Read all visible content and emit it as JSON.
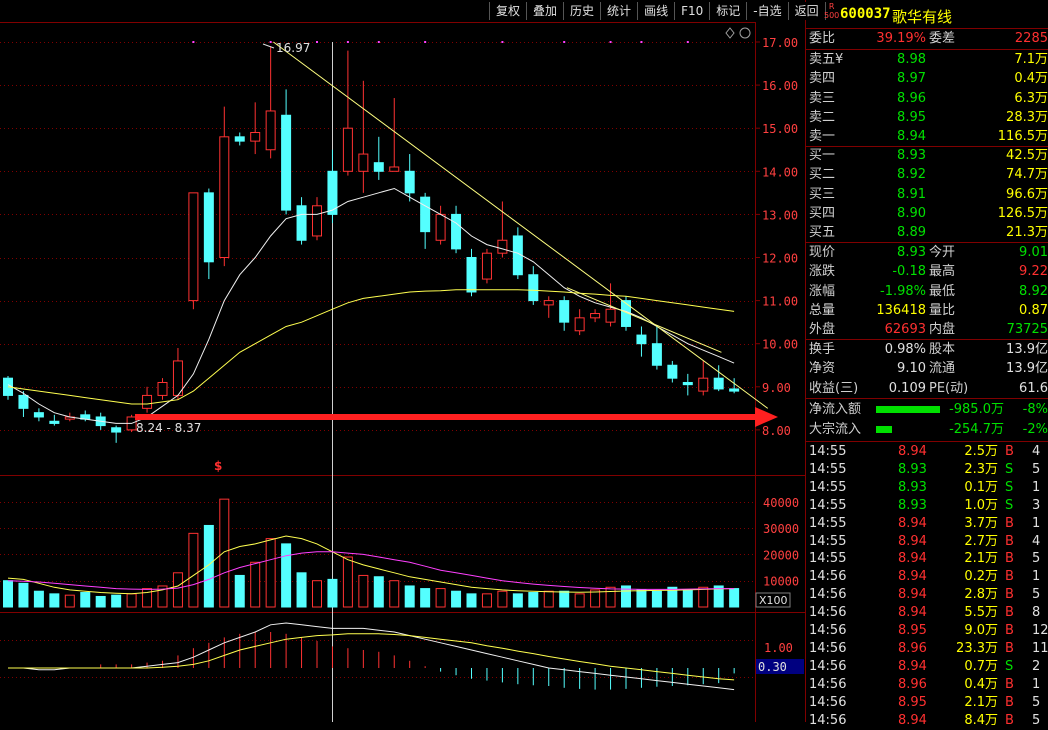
{
  "toolbar": [
    "复权",
    "叠加",
    "历史",
    "统计",
    "画线",
    "F10",
    "标记",
    "-自选",
    "返回"
  ],
  "stock": {
    "market_badge_top": "R",
    "market_badge_bottom": "500",
    "code": "600037",
    "name": "歌华有线"
  },
  "price_axis": [
    "17.00",
    "16.00",
    "15.00",
    "14.00",
    "13.00",
    "12.00",
    "11.00",
    "10.00",
    "9.00",
    "8.00"
  ],
  "volume_axis": [
    "40000",
    "30000",
    "20000",
    "10000"
  ],
  "volume_unit": "X100",
  "macd_axis": [
    "1.00",
    "0.30"
  ],
  "annotations": {
    "high_label": "16.97",
    "range_label": "8.24 - 8.37",
    "marker": "$"
  },
  "order_book": {
    "weibi_label": "委比",
    "weibi_value": "39.19%",
    "weicha_label": "委差",
    "weicha_value": "2285",
    "asks": [
      {
        "label": "卖五",
        "flag": "¥",
        "price": "8.98",
        "vol": "7.1万"
      },
      {
        "label": "卖四",
        "flag": "",
        "price": "8.97",
        "vol": "0.4万"
      },
      {
        "label": "卖三",
        "flag": "",
        "price": "8.96",
        "vol": "6.3万"
      },
      {
        "label": "卖二",
        "flag": "",
        "price": "8.95",
        "vol": "28.3万"
      },
      {
        "label": "卖一",
        "flag": "",
        "price": "8.94",
        "vol": "116.5万"
      }
    ],
    "bids": [
      {
        "label": "买一",
        "price": "8.93",
        "vol": "42.5万"
      },
      {
        "label": "买二",
        "price": "8.92",
        "vol": "74.7万"
      },
      {
        "label": "买三",
        "price": "8.91",
        "vol": "96.6万"
      },
      {
        "label": "买四",
        "price": "8.90",
        "vol": "126.5万"
      },
      {
        "label": "买五",
        "price": "8.89",
        "vol": "21.3万"
      }
    ]
  },
  "quote": [
    {
      "l1": "现价",
      "v1": "8.93",
      "c1": "grn",
      "l2": "今开",
      "v2": "9.01",
      "c2": "grn"
    },
    {
      "l1": "涨跌",
      "v1": "-0.18",
      "c1": "grn",
      "l2": "最高",
      "v2": "9.22",
      "c2": "red"
    },
    {
      "l1": "涨幅",
      "v1": "-1.98%",
      "c1": "grn",
      "l2": "最低",
      "v2": "8.92",
      "c2": "grn"
    },
    {
      "l1": "总量",
      "v1": "136418",
      "c1": "yel",
      "l2": "量比",
      "v2": "0.87",
      "c2": "yel"
    },
    {
      "l1": "外盘",
      "v1": "62693",
      "c1": "red",
      "l2": "内盘",
      "v2": "73725",
      "c2": "grn"
    }
  ],
  "fundamentals": [
    {
      "l1": "换手",
      "v1": "0.98%",
      "l2": "股本",
      "v2": "13.9亿"
    },
    {
      "l1": "净资",
      "v1": "9.10",
      "l2": "流通",
      "v2": "13.9亿"
    },
    {
      "l1": "收益(三)",
      "v1": "0.109",
      "l2": "PE(动)",
      "v2": "61.6"
    }
  ],
  "flows": [
    {
      "label": "净流入额",
      "value": "-985.0万",
      "pct": "-8%"
    },
    {
      "label": "大宗流入",
      "value": "-254.7万",
      "pct": "-2%"
    }
  ],
  "ticks": [
    {
      "t": "14:55",
      "p": "8.94",
      "v": "2.5万",
      "s": "B",
      "n": "4"
    },
    {
      "t": "14:55",
      "p": "8.93",
      "v": "2.3万",
      "s": "S",
      "n": "5"
    },
    {
      "t": "14:55",
      "p": "8.93",
      "v": "0.1万",
      "s": "S",
      "n": "1"
    },
    {
      "t": "14:55",
      "p": "8.93",
      "v": "1.0万",
      "s": "S",
      "n": "3"
    },
    {
      "t": "14:55",
      "p": "8.94",
      "v": "3.7万",
      "s": "B",
      "n": "1"
    },
    {
      "t": "14:55",
      "p": "8.94",
      "v": "2.7万",
      "s": "B",
      "n": "4"
    },
    {
      "t": "14:55",
      "p": "8.94",
      "v": "2.1万",
      "s": "B",
      "n": "5"
    },
    {
      "t": "14:56",
      "p": "8.94",
      "v": "0.2万",
      "s": "B",
      "n": "1"
    },
    {
      "t": "14:56",
      "p": "8.94",
      "v": "2.8万",
      "s": "B",
      "n": "5"
    },
    {
      "t": "14:56",
      "p": "8.94",
      "v": "5.5万",
      "s": "B",
      "n": "8"
    },
    {
      "t": "14:56",
      "p": "8.95",
      "v": "9.0万",
      "s": "B",
      "n": "12"
    },
    {
      "t": "14:56",
      "p": "8.96",
      "v": "23.3万",
      "s": "B",
      "n": "11"
    },
    {
      "t": "14:56",
      "p": "8.94",
      "v": "0.7万",
      "s": "S",
      "n": "2"
    },
    {
      "t": "14:56",
      "p": "8.96",
      "v": "0.4万",
      "s": "B",
      "n": "1"
    },
    {
      "t": "14:56",
      "p": "8.95",
      "v": "2.1万",
      "s": "B",
      "n": "5"
    },
    {
      "t": "14:56",
      "p": "8.94",
      "v": "8.4万",
      "s": "B",
      "n": "5"
    }
  ],
  "colors": {
    "up": "#ff3232",
    "down": "#54ffff",
    "ma_white": "#f0f0f0",
    "ma_yellow": "#ffff50",
    "ma_magenta": "#ff40ff",
    "grid": "#800000",
    "arrow": "#ff2020"
  },
  "chart_data": {
    "type": "candlestick",
    "ylim": [
      7.6,
      17.3
    ],
    "candles": [
      [
        9.2,
        8.8,
        9.25,
        8.7
      ],
      [
        8.8,
        8.5,
        8.9,
        8.3
      ],
      [
        8.4,
        8.3,
        8.5,
        8.2
      ],
      [
        8.2,
        8.15,
        8.35,
        8.1
      ],
      [
        8.25,
        8.3,
        8.4,
        8.2
      ],
      [
        8.35,
        8.25,
        8.45,
        8.2
      ],
      [
        8.3,
        8.1,
        8.4,
        8.0
      ],
      [
        8.05,
        7.95,
        8.1,
        7.7
      ],
      [
        8.0,
        8.3,
        8.35,
        7.95
      ],
      [
        8.5,
        8.8,
        9.0,
        8.4
      ],
      [
        8.8,
        9.1,
        9.2,
        8.7
      ],
      [
        8.8,
        9.6,
        9.9,
        8.7
      ],
      [
        11.0,
        13.5,
        13.5,
        10.8
      ],
      [
        13.5,
        11.9,
        13.6,
        11.5
      ],
      [
        12.0,
        14.8,
        15.5,
        11.8
      ],
      [
        14.8,
        14.7,
        14.9,
        14.6
      ],
      [
        14.7,
        14.9,
        15.6,
        14.4
      ],
      [
        14.5,
        15.4,
        16.9,
        14.3
      ],
      [
        15.3,
        13.1,
        15.9,
        13.0
      ],
      [
        13.2,
        12.4,
        13.4,
        12.3
      ],
      [
        12.5,
        13.2,
        13.4,
        12.4
      ],
      [
        14.0,
        13.0,
        14.5,
        12.8
      ],
      [
        14.0,
        15.0,
        16.8,
        13.9
      ],
      [
        14.0,
        14.4,
        16.1,
        13.5
      ],
      [
        14.2,
        14.0,
        14.8,
        13.8
      ],
      [
        14.0,
        14.1,
        15.7,
        14.0
      ],
      [
        14.0,
        13.5,
        14.4,
        13.3
      ],
      [
        13.4,
        12.6,
        13.5,
        12.2
      ],
      [
        12.4,
        13.0,
        13.2,
        12.3
      ],
      [
        13.0,
        12.2,
        13.2,
        12.1
      ],
      [
        12.0,
        11.2,
        12.2,
        11.1
      ],
      [
        11.5,
        12.1,
        12.2,
        11.4
      ],
      [
        12.1,
        12.4,
        13.3,
        12.0
      ],
      [
        12.5,
        11.6,
        12.7,
        11.5
      ],
      [
        11.6,
        11.0,
        11.8,
        10.9
      ],
      [
        10.9,
        11.0,
        11.1,
        10.6
      ],
      [
        11.0,
        10.5,
        11.1,
        10.3
      ],
      [
        10.3,
        10.6,
        10.8,
        10.2
      ],
      [
        10.6,
        10.7,
        10.8,
        10.5
      ],
      [
        10.5,
        10.8,
        11.4,
        10.4
      ],
      [
        11.0,
        10.4,
        11.1,
        10.3
      ],
      [
        10.2,
        10.0,
        10.4,
        9.7
      ],
      [
        10.0,
        9.5,
        10.4,
        9.4
      ],
      [
        9.5,
        9.2,
        9.6,
        9.1
      ],
      [
        9.1,
        9.05,
        9.3,
        8.8
      ],
      [
        8.9,
        9.2,
        9.6,
        8.8
      ],
      [
        9.2,
        8.95,
        9.5,
        8.9
      ],
      [
        8.95,
        8.9,
        9.2,
        8.85
      ]
    ],
    "ma_white": [
      9.05,
      8.85,
      8.6,
      8.4,
      8.3,
      8.25,
      8.2,
      8.15,
      8.15,
      8.3,
      8.55,
      8.8,
      9.3,
      10.1,
      11.0,
      11.6,
      12.0,
      12.5,
      12.9,
      13.0,
      13.0,
      13.1,
      13.3,
      13.4,
      13.5,
      13.6,
      13.4,
      13.2,
      13.0,
      12.8,
      12.5,
      12.3,
      12.2,
      12.1,
      11.9,
      11.6,
      11.3,
      11.1,
      10.95,
      10.85,
      10.75,
      10.6,
      10.4,
      10.2,
      10.0,
      9.85,
      9.7,
      9.55
    ],
    "ma_yellow": [
      9.0,
      8.95,
      8.9,
      8.85,
      8.8,
      8.75,
      8.7,
      8.65,
      8.6,
      8.6,
      8.65,
      8.7,
      8.9,
      9.2,
      9.5,
      9.8,
      10.0,
      10.2,
      10.4,
      10.5,
      10.65,
      10.8,
      10.95,
      11.05,
      11.1,
      11.15,
      11.2,
      11.22,
      11.23,
      11.25,
      11.25,
      11.25,
      11.25,
      11.25,
      11.24,
      11.22,
      11.2,
      11.17,
      11.15,
      11.12,
      11.1,
      11.05,
      11.0,
      10.95,
      10.9,
      10.85,
      10.8,
      10.75
    ],
    "trend_lines": [
      {
        "from": [
          17.5,
          17.0
        ],
        "to": [
          49.5,
          8.5
        ]
      },
      {
        "from": [
          36.5,
          11.3
        ],
        "to": [
          46.5,
          9.8
        ]
      }
    ],
    "support_arrow_price": 8.3,
    "volume": [
      10000,
      9000,
      6000,
      5000,
      4500,
      5500,
      4000,
      4500,
      5000,
      7000,
      8000,
      13000,
      28000,
      31000,
      41000,
      12000,
      17000,
      26000,
      24000,
      13000,
      10000,
      10500,
      19000,
      12000,
      11500,
      10000,
      8000,
      7000,
      7000,
      6000,
      5000,
      5000,
      6000,
      5000,
      5500,
      6000,
      6000,
      5000,
      6500,
      7500,
      8000,
      6500,
      6000,
      7500,
      6500,
      7500,
      8000,
      7000
    ],
    "volume_ylim": [
      0,
      46000
    ],
    "vol_ma_yellow": [
      11000,
      10500,
      9000,
      7500,
      6500,
      6000,
      5500,
      5200,
      5000,
      5500,
      6500,
      8000,
      12000,
      16000,
      21000,
      23000,
      24000,
      25500,
      27000,
      26000,
      24000,
      21000,
      18000,
      16000,
      14500,
      13000,
      11500,
      10500,
      9500,
      8500,
      7500,
      7000,
      6500,
      6200,
      6000,
      5800,
      5700,
      5600,
      5700,
      5900,
      6100,
      6200,
      6300,
      6400,
      6500,
      6700,
      6900,
      7000
    ],
    "vol_ma_magenta": [
      10000,
      9800,
      9500,
      9000,
      8500,
      8000,
      7500,
      7000,
      6800,
      6700,
      6800,
      7200,
      8500,
      10500,
      13000,
      15000,
      16500,
      18000,
      19500,
      20500,
      21000,
      21000,
      20500,
      20000,
      19000,
      18000,
      17000,
      15500,
      14000,
      13000,
      12000,
      11000,
      10000,
      9300,
      8700,
      8200,
      7800,
      7400,
      7100,
      6900,
      6800,
      6700,
      6700,
      6700,
      6800,
      6900,
      7000,
      7000
    ],
    "macd_hist": [
      0,
      0,
      0,
      0,
      0,
      0,
      0.1,
      0.1,
      0.1,
      0.15,
      0.2,
      0.35,
      0.55,
      0.7,
      0.85,
      0.95,
      1.0,
      1.0,
      0.95,
      0.85,
      0.75,
      0.6,
      0.55,
      0.5,
      0.45,
      0.35,
      0.2,
      0.05,
      -0.1,
      -0.2,
      -0.3,
      -0.35,
      -0.4,
      -0.45,
      -0.48,
      -0.5,
      -0.55,
      -0.58,
      -0.6,
      -0.6,
      -0.58,
      -0.55,
      -0.52,
      -0.5,
      -0.48,
      -0.45,
      -0.42,
      -0.15
    ],
    "macd_dif": [
      0,
      0,
      -0.05,
      -0.05,
      0,
      0,
      0,
      0,
      0,
      0.05,
      0.1,
      0.15,
      0.3,
      0.5,
      0.7,
      0.85,
      1.0,
      1.2,
      1.25,
      1.2,
      1.15,
      1.1,
      1.1,
      1.1,
      1.05,
      1.0,
      0.9,
      0.8,
      0.7,
      0.6,
      0.5,
      0.4,
      0.3,
      0.2,
      0.1,
      0.0,
      -0.05,
      -0.1,
      -0.15,
      -0.2,
      -0.25,
      -0.3,
      -0.35,
      -0.4,
      -0.45,
      -0.5,
      -0.55,
      -0.6
    ],
    "macd_dea": [
      0,
      0,
      0,
      0,
      0,
      0,
      0,
      0,
      0,
      0,
      0.02,
      0.05,
      0.1,
      0.2,
      0.35,
      0.5,
      0.6,
      0.7,
      0.8,
      0.85,
      0.9,
      0.92,
      0.95,
      0.95,
      0.95,
      0.93,
      0.9,
      0.85,
      0.8,
      0.75,
      0.7,
      0.62,
      0.55,
      0.47,
      0.4,
      0.32,
      0.25,
      0.18,
      0.12,
      0.05,
      0.0,
      -0.05,
      -0.1,
      -0.15,
      -0.2,
      -0.25,
      -0.3,
      -0.33
    ],
    "macd_ylim": [
      -0.75,
      1.5
    ]
  }
}
